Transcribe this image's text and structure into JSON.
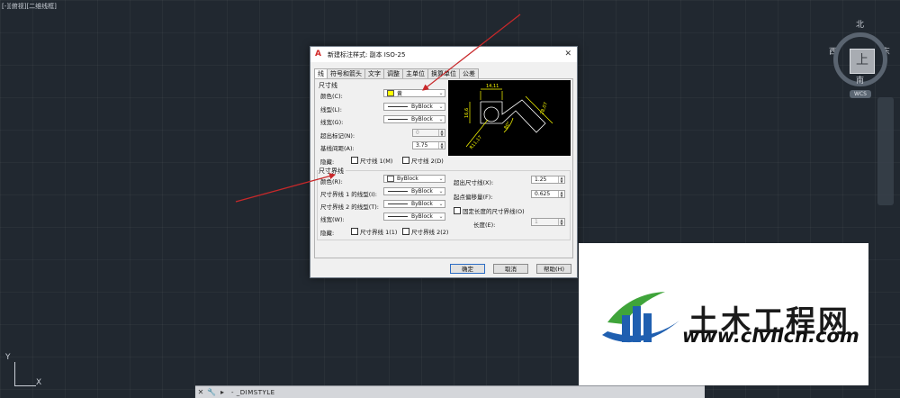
{
  "viewport": {
    "label": "[-][俯视][二维线框]"
  },
  "viewcube": {
    "north": "北",
    "south": "南",
    "west": "西",
    "east": "东",
    "face": "上",
    "wcs": "WCS"
  },
  "ucs": {
    "y": "Y",
    "x": "X"
  },
  "command": {
    "text": "- _DIMSTYLE",
    "close_icon": "close-icon",
    "wrench_icon": "wrench-icon"
  },
  "dialog": {
    "title": "新建标注样式: 副本 ISO-25",
    "tabs": [
      "线",
      "符号和箭头",
      "文字",
      "调整",
      "主单位",
      "换算单位",
      "公差"
    ],
    "dim_lines": {
      "group": "尺寸线",
      "color_label": "颜色(C):",
      "color_value": "黄",
      "linetype_label": "线型(L):",
      "linetype_value": "ByBlock",
      "lineweight_label": "线宽(G):",
      "lineweight_value": "ByBlock",
      "extend_ticks_label": "超出标记(N):",
      "extend_ticks_value": "0",
      "baseline_label": "基线间距(A):",
      "baseline_value": "3.75",
      "suppress_label": "隐藏:",
      "suppress_1": "尺寸线 1(M)",
      "suppress_2": "尺寸线 2(D)"
    },
    "ext_lines": {
      "group": "尺寸界线",
      "color_label": "颜色(R):",
      "color_value": "ByBlock",
      "lt1_label": "尺寸界线 1 的线型(I):",
      "lt1_value": "ByBlock",
      "lt2_label": "尺寸界线 2 的线型(T):",
      "lt2_value": "ByBlock",
      "lineweight_label": "线宽(W):",
      "lineweight_value": "ByBlock",
      "suppress_label": "隐藏:",
      "suppress_1": "尺寸界线 1(1)",
      "suppress_2": "尺寸界线 2(2)",
      "extend_label": "超出尺寸线(X):",
      "extend_value": "1.25",
      "offset_label": "起点偏移量(F):",
      "offset_value": "0.625",
      "fixed_label": "固定长度的尺寸界线(O)",
      "length_label": "长度(E):",
      "length_value": "1"
    },
    "preview": {
      "dims": [
        "14,11",
        "16,6",
        "28,07",
        "80°",
        "R11,17"
      ]
    },
    "buttons": {
      "ok": "确定",
      "cancel": "取消",
      "help": "帮助(H)"
    }
  },
  "watermark": {
    "title": "土木工程网",
    "url": "www.civilcn.com"
  },
  "colors": {
    "accent": "#d32a2a",
    "dim_yellow": "#ffff00",
    "arrow": "#c8282a",
    "logo_blue": "#1f5fb0",
    "logo_green": "#3fa43a"
  }
}
